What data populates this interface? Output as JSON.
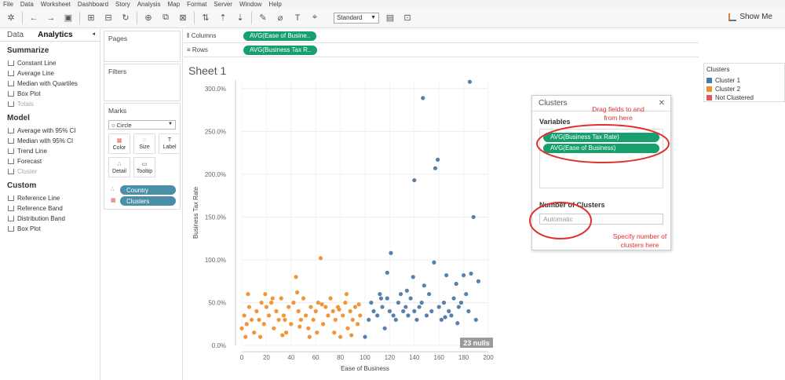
{
  "menu": [
    "File",
    "Data",
    "Worksheet",
    "Dashboard",
    "Story",
    "Analysis",
    "Map",
    "Format",
    "Server",
    "Window",
    "Help"
  ],
  "toolbar": {
    "fit": "Standard",
    "show_me": "Show Me"
  },
  "left_panel": {
    "tabs": [
      "Data",
      "Analytics"
    ],
    "summarize": {
      "title": "Summarize",
      "items": [
        "Constant Line",
        "Average Line",
        "Median with Quartiles",
        "Box Plot",
        "Totals"
      ]
    },
    "model": {
      "title": "Model",
      "items": [
        "Average with 95% CI",
        "Median with 95% CI",
        "Trend Line",
        "Forecast",
        "Cluster"
      ]
    },
    "custom": {
      "title": "Custom",
      "items": [
        "Reference Line",
        "Reference Band",
        "Distribution Band",
        "Box Plot"
      ]
    }
  },
  "cards": {
    "pages": "Pages",
    "filters": "Filters",
    "marks": "Marks",
    "mark_type": "Circle",
    "mark_buttons": [
      "Color",
      "Size",
      "Label",
      "Detail",
      "Tooltip"
    ],
    "pills": [
      "Country",
      "Clusters"
    ]
  },
  "shelves": {
    "columns_label": "Columns",
    "columns_pill": "AVG(Ease of Busine..",
    "rows_label": "Rows",
    "rows_pill": "AVG(Business Tax R.."
  },
  "sheet_title": "Sheet 1",
  "legend": {
    "title": "Clusters",
    "items": [
      {
        "label": "Cluster 1",
        "color": "#4e79a7"
      },
      {
        "label": "Cluster 2",
        "color": "#f28e2b"
      },
      {
        "label": "Not Clustered",
        "color": "#e15759"
      }
    ]
  },
  "dialog": {
    "title": "Clusters",
    "variables_title": "Variables",
    "variables": [
      "AVG(Business Tax Rate)",
      "AVG(Ease of Business)"
    ],
    "num_title": "Number of Clusters",
    "num_placeholder": "Automatic"
  },
  "annotations": {
    "drag": "Drag fields to and from here",
    "specify": "Specify number of clusters here"
  },
  "chart_data": {
    "type": "scatter",
    "xlabel": "Ease of Business",
    "ylabel": "Business Tax Rate",
    "xlim": [
      0,
      200
    ],
    "ylim": [
      0,
      3.1
    ],
    "xticks": [
      0,
      20,
      40,
      60,
      80,
      100,
      120,
      140,
      160,
      180,
      200
    ],
    "yticks": [
      "0.0%",
      "50.0%",
      "100.0%",
      "150.0%",
      "200.0%",
      "250.0%",
      "300.0%"
    ],
    "nulls_badge": "23 nulls",
    "series": [
      {
        "name": "Cluster 1",
        "color": "#4e79a7",
        "points": [
          [
            100,
            0.1
          ],
          [
            103,
            0.3
          ],
          [
            105,
            0.5
          ],
          [
            107,
            0.4
          ],
          [
            110,
            0.35
          ],
          [
            112,
            0.6
          ],
          [
            114,
            0.45
          ],
          [
            116,
            0.2
          ],
          [
            118,
            0.55
          ],
          [
            120,
            0.4
          ],
          [
            121,
            1.08
          ],
          [
            123,
            0.35
          ],
          [
            125,
            0.3
          ],
          [
            127,
            0.5
          ],
          [
            129,
            0.6
          ],
          [
            131,
            0.4
          ],
          [
            133,
            0.45
          ],
          [
            135,
            0.35
          ],
          [
            137,
            0.55
          ],
          [
            139,
            0.8
          ],
          [
            140,
            0.4
          ],
          [
            142,
            0.3
          ],
          [
            144,
            0.45
          ],
          [
            146,
            0.5
          ],
          [
            148,
            0.7
          ],
          [
            150,
            0.35
          ],
          [
            152,
            0.6
          ],
          [
            154,
            0.4
          ],
          [
            156,
            0.97
          ],
          [
            157,
            2.07
          ],
          [
            159,
            2.17
          ],
          [
            160,
            0.45
          ],
          [
            162,
            0.3
          ],
          [
            164,
            0.5
          ],
          [
            166,
            0.82
          ],
          [
            168,
            0.4
          ],
          [
            170,
            0.35
          ],
          [
            172,
            0.55
          ],
          [
            174,
            0.72
          ],
          [
            176,
            0.45
          ],
          [
            178,
            0.5
          ],
          [
            180,
            0.82
          ],
          [
            182,
            0.6
          ],
          [
            184,
            0.4
          ],
          [
            185,
            3.08
          ],
          [
            186,
            0.84
          ],
          [
            188,
            1.5
          ],
          [
            190,
            0.3
          ],
          [
            192,
            0.75
          ],
          [
            147,
            2.89
          ],
          [
            140,
            1.93
          ],
          [
            113,
            0.55
          ],
          [
            118,
            0.85
          ],
          [
            134,
            0.64
          ],
          [
            165,
            0.33
          ],
          [
            175,
            0.26
          ]
        ]
      },
      {
        "name": "Cluster 2",
        "color": "#f28e2b",
        "points": [
          [
            0,
            0.2
          ],
          [
            2,
            0.35
          ],
          [
            4,
            0.25
          ],
          [
            6,
            0.45
          ],
          [
            8,
            0.3
          ],
          [
            10,
            0.15
          ],
          [
            12,
            0.4
          ],
          [
            14,
            0.3
          ],
          [
            16,
            0.5
          ],
          [
            18,
            0.25
          ],
          [
            20,
            0.45
          ],
          [
            22,
            0.35
          ],
          [
            24,
            0.5
          ],
          [
            26,
            0.2
          ],
          [
            28,
            0.4
          ],
          [
            30,
            0.3
          ],
          [
            32,
            0.55
          ],
          [
            34,
            0.35
          ],
          [
            36,
            0.15
          ],
          [
            38,
            0.45
          ],
          [
            40,
            0.25
          ],
          [
            42,
            0.5
          ],
          [
            44,
            0.8
          ],
          [
            46,
            0.4
          ],
          [
            48,
            0.3
          ],
          [
            50,
            0.55
          ],
          [
            52,
            0.35
          ],
          [
            54,
            0.2
          ],
          [
            56,
            0.45
          ],
          [
            58,
            0.3
          ],
          [
            60,
            0.4
          ],
          [
            62,
            0.5
          ],
          [
            64,
            1.02
          ],
          [
            66,
            0.25
          ],
          [
            68,
            0.45
          ],
          [
            70,
            0.35
          ],
          [
            72,
            0.55
          ],
          [
            74,
            0.4
          ],
          [
            76,
            0.3
          ],
          [
            78,
            0.45
          ],
          [
            80,
            0.1
          ],
          [
            82,
            0.35
          ],
          [
            84,
            0.5
          ],
          [
            86,
            0.2
          ],
          [
            88,
            0.4
          ],
          [
            90,
            0.3
          ],
          [
            92,
            0.45
          ],
          [
            94,
            0.25
          ],
          [
            96,
            0.35
          ],
          [
            5,
            0.6
          ],
          [
            15,
            0.1
          ],
          [
            25,
            0.55
          ],
          [
            35,
            0.3
          ],
          [
            45,
            0.62
          ],
          [
            55,
            0.1
          ],
          [
            65,
            0.48
          ],
          [
            75,
            0.15
          ],
          [
            85,
            0.6
          ],
          [
            95,
            0.48
          ],
          [
            3,
            0.1
          ],
          [
            19,
            0.6
          ],
          [
            33,
            0.12
          ],
          [
            47,
            0.22
          ],
          [
            61,
            0.15
          ],
          [
            79,
            0.42
          ],
          [
            89,
            0.12
          ]
        ]
      }
    ]
  }
}
